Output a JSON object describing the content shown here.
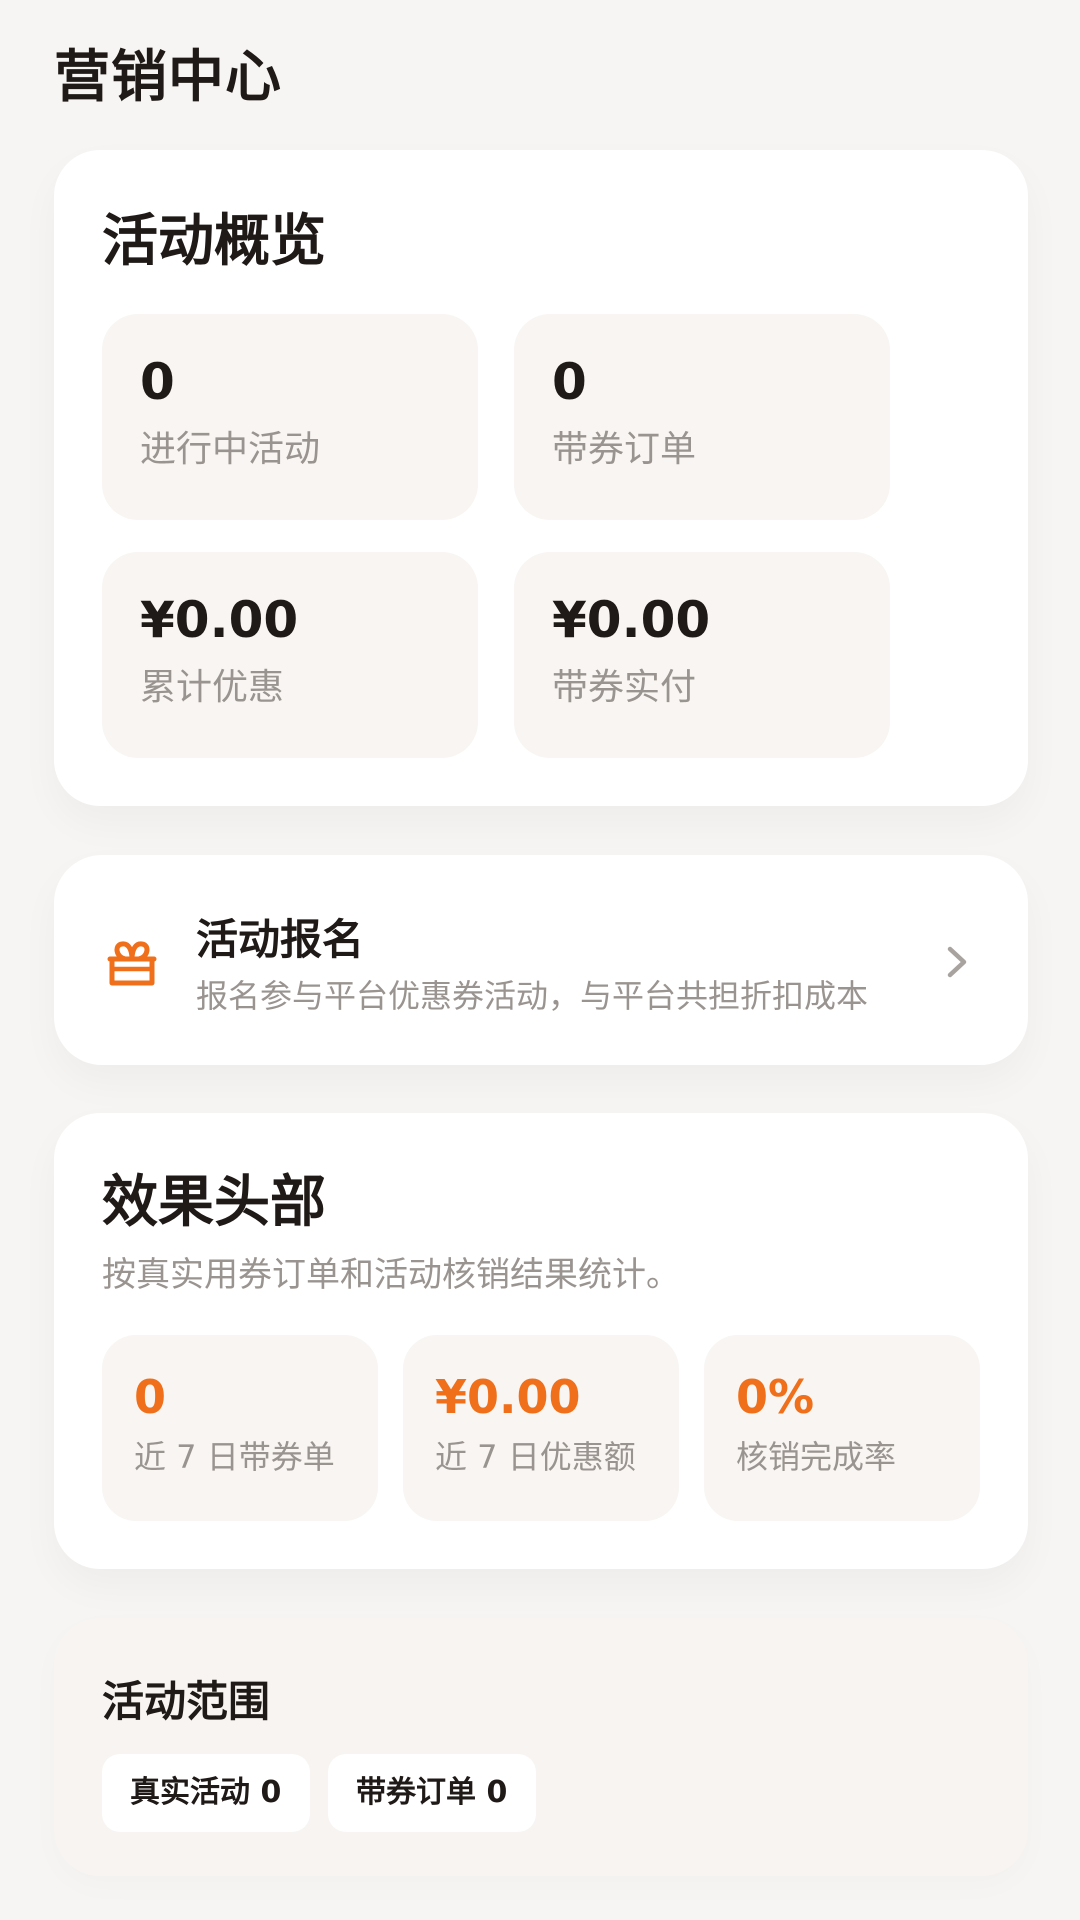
{
  "header": {
    "title": "营销中心"
  },
  "overview": {
    "title": "活动概览",
    "stats": [
      {
        "value": "0",
        "label": "进行中活动"
      },
      {
        "value": "0",
        "label": "带券订单"
      },
      {
        "value": "¥0.00",
        "label": "累计优惠"
      },
      {
        "value": "¥0.00",
        "label": "带券实付"
      }
    ]
  },
  "signup": {
    "title": "活动报名",
    "description": "报名参与平台优惠券活动，与平台共担折扣成本",
    "icon": "gift-icon",
    "accent_color": "#ef6f1a"
  },
  "effect": {
    "title": "效果头部",
    "subtitle": "按真实用券订单和活动核销结果统计。",
    "metrics": [
      {
        "value": "0",
        "label": "近 7 日带券单"
      },
      {
        "value": "¥0.00",
        "label": "近 7 日优惠额"
      },
      {
        "value": "0%",
        "label": "核销完成率"
      }
    ]
  },
  "scope": {
    "title": "活动范围",
    "chips": [
      "真实活动 0",
      "带券订单 0"
    ]
  }
}
